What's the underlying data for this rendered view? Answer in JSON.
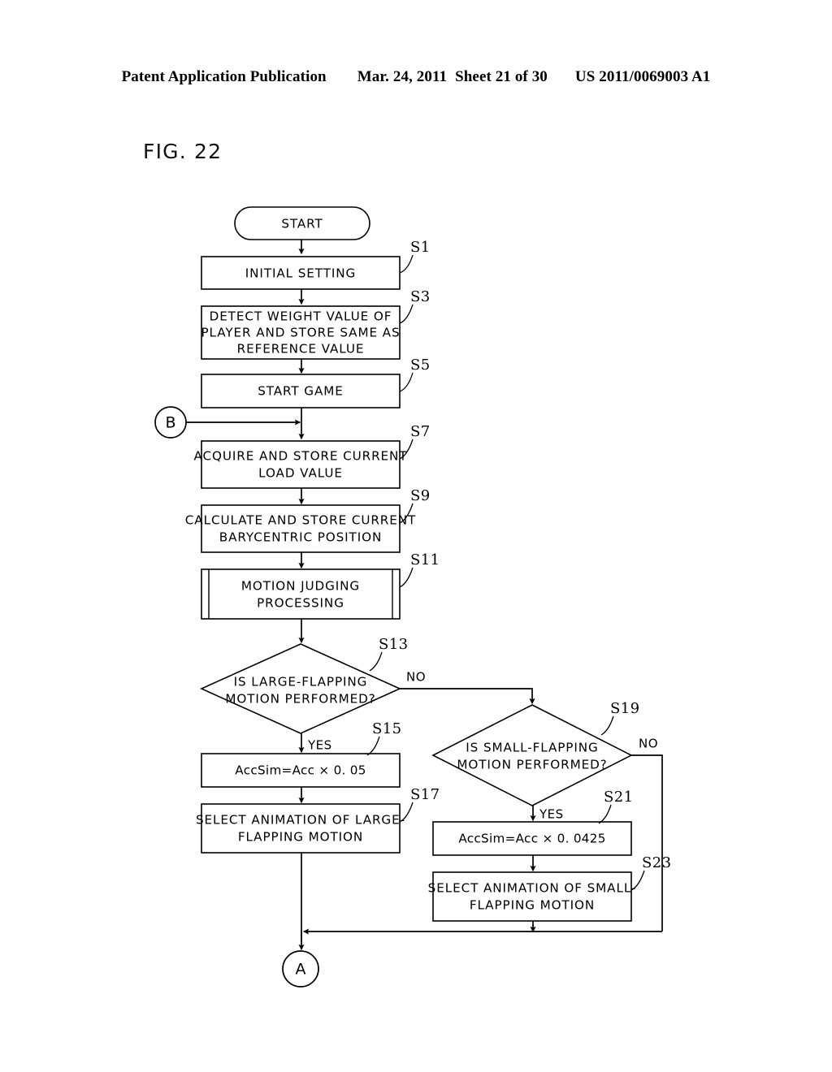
{
  "header": {
    "publication": "Patent Application Publication",
    "date": "Mar. 24, 2011",
    "sheet": "Sheet 21 of 30",
    "docnumber": "US 2011/0069003 A1"
  },
  "figure": {
    "title": "FIG. 22"
  },
  "flowchart": {
    "start": {
      "label": "START"
    },
    "connector_in": {
      "label": "B"
    },
    "connector_out": {
      "label": "A"
    },
    "branch_labels": {
      "yes": "YES",
      "no": "NO"
    },
    "steps": [
      {
        "id": "S1",
        "step_label": "S1",
        "shape": "process",
        "lines": [
          "INITIAL SETTING"
        ]
      },
      {
        "id": "S3",
        "step_label": "S3",
        "shape": "process",
        "lines": [
          "DETECT WEIGHT VALUE OF",
          "PLAYER AND STORE SAME AS",
          "REFERENCE VALUE"
        ]
      },
      {
        "id": "S5",
        "step_label": "S5",
        "shape": "process",
        "lines": [
          "START GAME"
        ]
      },
      {
        "id": "S7",
        "step_label": "S7",
        "shape": "process",
        "lines": [
          "ACQUIRE AND STORE CURRENT",
          "LOAD VALUE"
        ]
      },
      {
        "id": "S9",
        "step_label": "S9",
        "shape": "process",
        "lines": [
          "CALCULATE AND STORE CURRENT",
          "BARYCENTRIC POSITION"
        ]
      },
      {
        "id": "S11",
        "step_label": "S11",
        "shape": "subroutine",
        "lines": [
          "MOTION JUDGING",
          "PROCESSING"
        ]
      },
      {
        "id": "S13",
        "step_label": "S13",
        "shape": "decision",
        "lines": [
          "IS LARGE-FLAPPING",
          "MOTION PERFORMED?"
        ]
      },
      {
        "id": "S15",
        "step_label": "S15",
        "shape": "process",
        "lines": [
          "AccSim=Acc × 0. 05"
        ]
      },
      {
        "id": "S17",
        "step_label": "S17",
        "shape": "process",
        "lines": [
          "SELECT ANIMATION OF LARGE-",
          "FLAPPING MOTION"
        ]
      },
      {
        "id": "S19",
        "step_label": "S19",
        "shape": "decision",
        "lines": [
          "IS SMALL-FLAPPING",
          "MOTION PERFORMED?"
        ]
      },
      {
        "id": "S21",
        "step_label": "S21",
        "shape": "process",
        "lines": [
          "AccSim=Acc × 0. 0425"
        ]
      },
      {
        "id": "S23",
        "step_label": "S23",
        "shape": "process",
        "lines": [
          "SELECT ANIMATION OF SMALL-",
          "FLAPPING MOTION"
        ]
      }
    ]
  },
  "colors": {
    "ink": "#000000",
    "paper": "#ffffff"
  }
}
